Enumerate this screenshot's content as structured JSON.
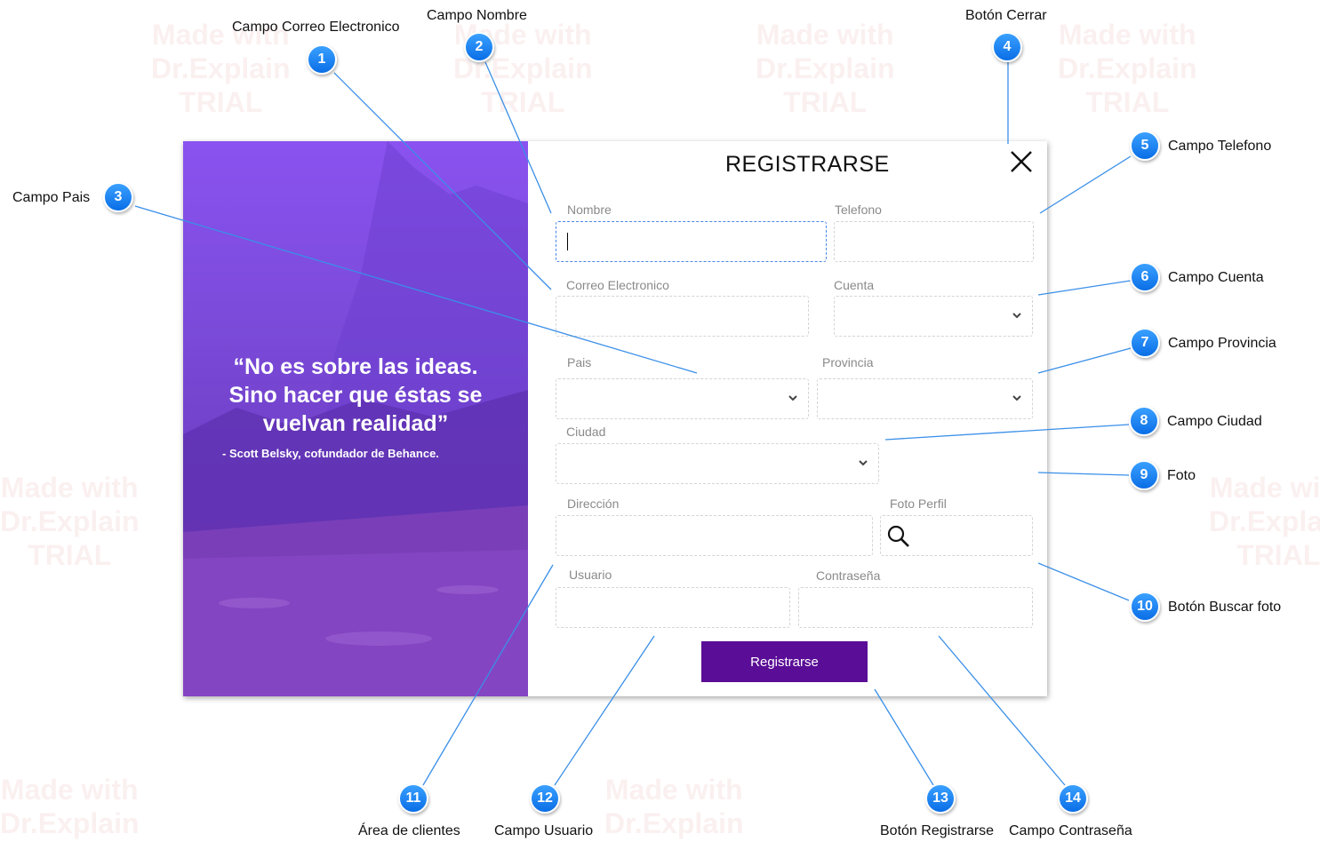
{
  "watermark": {
    "line1": "Made with",
    "line2": "Dr.Explain",
    "line3": "TRIAL"
  },
  "window": {
    "title": "REGISTRARSE",
    "quote": "“No es sobre las ideas. Sino hacer que éstas se vuelvan realidad”",
    "author": "- Scott Belsky, cofundador de Behance.",
    "labels": {
      "nombre": "Nombre",
      "telefono": "Telefono",
      "correo": "Correo Electronico",
      "cuenta": "Cuenta",
      "pais": "Pais",
      "provincia": "Provincia",
      "ciudad": "Ciudad",
      "direccion": "Dirección",
      "foto": "Foto Perfil",
      "usuario": "Usuario",
      "contrasena": "Contraseña"
    },
    "register_button": "Registrarse",
    "accent": "#5a0d96"
  },
  "callouts": [
    {
      "num": "1",
      "label": "Campo Correo Electronico"
    },
    {
      "num": "2",
      "label": "Campo Nombre"
    },
    {
      "num": "3",
      "label": "Campo Pais"
    },
    {
      "num": "4",
      "label": "Botón Cerrar"
    },
    {
      "num": "5",
      "label": "Campo Telefono"
    },
    {
      "num": "6",
      "label": "Campo Cuenta"
    },
    {
      "num": "7",
      "label": "Campo Provincia"
    },
    {
      "num": "8",
      "label": "Campo Ciudad"
    },
    {
      "num": "9",
      "label": "Foto"
    },
    {
      "num": "10",
      "label": "Botón Buscar foto"
    },
    {
      "num": "11",
      "label": "Área de clientes"
    },
    {
      "num": "12",
      "label": "Campo Usuario"
    },
    {
      "num": "13",
      "label": "Botón Registrarse"
    },
    {
      "num": "14",
      "label": "Campo Contraseña"
    }
  ],
  "icons": {
    "close": "close-icon",
    "search": "search-icon",
    "dropdown": "chevron-down-icon"
  }
}
